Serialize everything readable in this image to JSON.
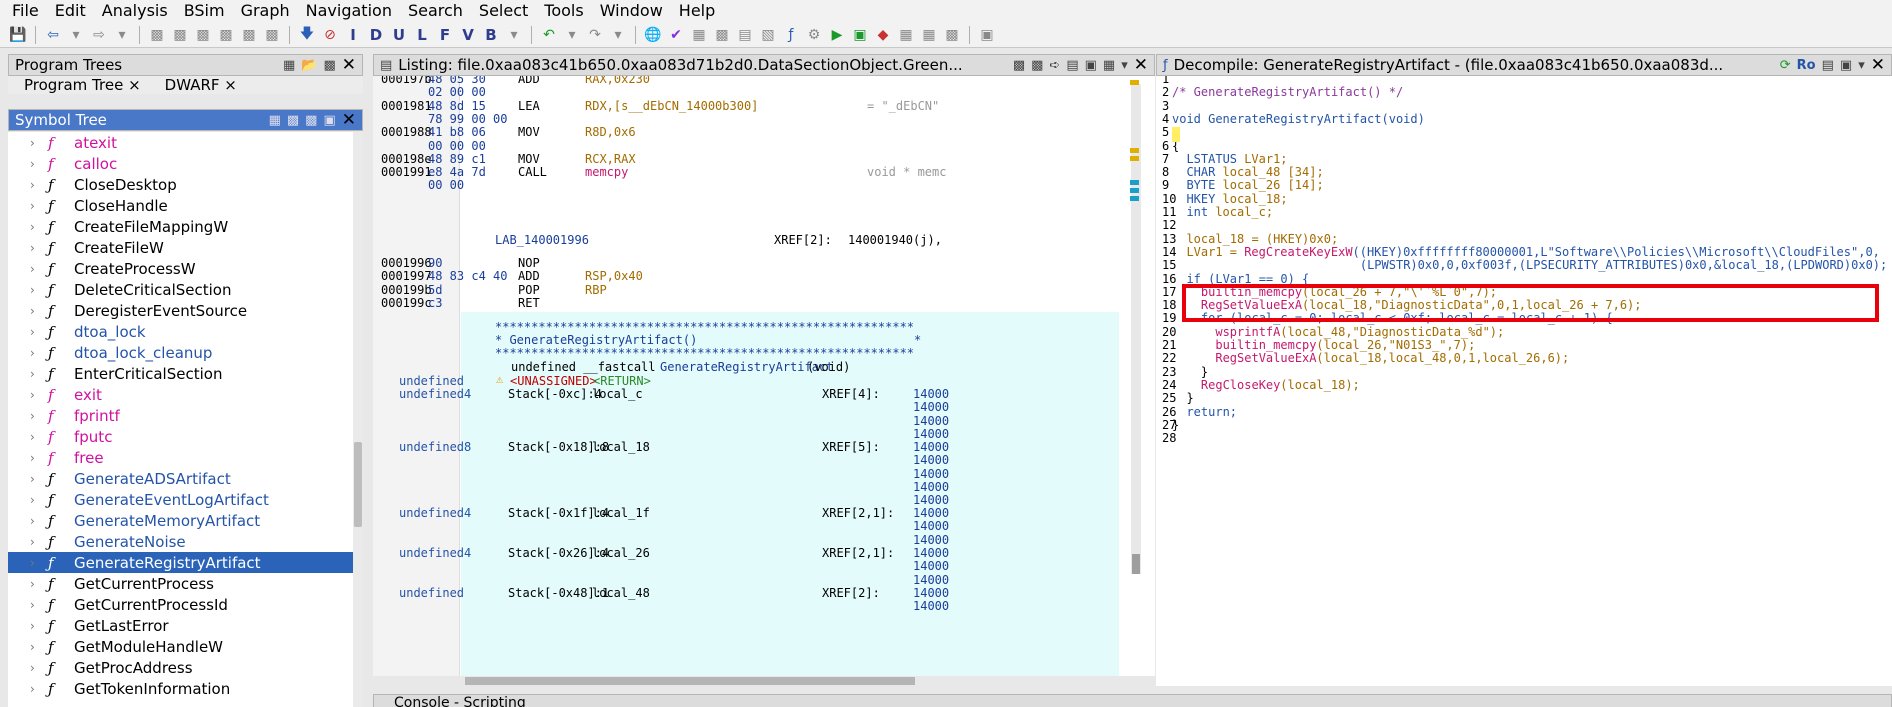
{
  "menu": [
    "File",
    "Edit",
    "Analysis",
    "BSim",
    "Graph",
    "Navigation",
    "Search",
    "Select",
    "Tools",
    "Window",
    "Help"
  ],
  "toolbar": {
    "letter_buttons": [
      "I",
      "D",
      "U",
      "L",
      "F",
      "V",
      "B"
    ]
  },
  "program_trees": {
    "title": "Program Trees",
    "tabs": [
      "Program Tree ×",
      "DWARF ×"
    ]
  },
  "symbol_tree": {
    "title": "Symbol Tree",
    "items": [
      {
        "name": "atexit",
        "color": "magenta"
      },
      {
        "name": "calloc",
        "color": "magenta"
      },
      {
        "name": "CloseDesktop",
        "color": "black"
      },
      {
        "name": "CloseHandle",
        "color": "black"
      },
      {
        "name": "CreateFileMappingW",
        "color": "black"
      },
      {
        "name": "CreateFileW",
        "color": "black"
      },
      {
        "name": "CreateProcessW",
        "color": "black"
      },
      {
        "name": "DeleteCriticalSection",
        "color": "black"
      },
      {
        "name": "DeregisterEventSource",
        "color": "black"
      },
      {
        "name": "dtoa_lock",
        "color": "blue"
      },
      {
        "name": "dtoa_lock_cleanup",
        "color": "blue"
      },
      {
        "name": "EnterCriticalSection",
        "color": "black"
      },
      {
        "name": "exit",
        "color": "magenta"
      },
      {
        "name": "fprintf",
        "color": "magenta"
      },
      {
        "name": "fputc",
        "color": "magenta"
      },
      {
        "name": "free",
        "color": "magenta"
      },
      {
        "name": "GenerateADSArtifact",
        "color": "blue"
      },
      {
        "name": "GenerateEventLogArtifact",
        "color": "blue"
      },
      {
        "name": "GenerateMemoryArtifact",
        "color": "blue"
      },
      {
        "name": "GenerateNoise",
        "color": "blue"
      },
      {
        "name": "GenerateRegistryArtifact",
        "color": "selected"
      },
      {
        "name": "GetCurrentProcess",
        "color": "black"
      },
      {
        "name": "GetCurrentProcessId",
        "color": "black"
      },
      {
        "name": "GetLastError",
        "color": "black"
      },
      {
        "name": "GetModuleHandleW",
        "color": "black"
      },
      {
        "name": "GetProcAddress",
        "color": "black"
      },
      {
        "name": "GetTokenInformation",
        "color": "black"
      }
    ]
  },
  "listing": {
    "title": "Listing:  file.0xaa083c41b650.0xaa083d71b2d0.DataSectionObject.Green...",
    "rows": [
      {
        "addr": "000197b",
        "bytes": "48 05 30",
        "mn": "ADD",
        "op": "RAX,0x230",
        "extra": ""
      },
      {
        "addr": "",
        "bytes": "02 00 00",
        "mn": "",
        "op": "",
        "extra": ""
      },
      {
        "addr": "0001981",
        "bytes": "48 8d 15",
        "mn": "LEA",
        "op": "RDX,[s__dEbCN_14000b300]",
        "extra": "= \"_dEbCN\""
      },
      {
        "addr": "",
        "bytes": "78 99 00 00",
        "mn": "",
        "op": "",
        "extra": ""
      },
      {
        "addr": "0001988",
        "bytes": "41 b8 06",
        "mn": "MOV",
        "op": "R8D,0x6",
        "extra": ""
      },
      {
        "addr": "",
        "bytes": "00 00 00",
        "mn": "",
        "op": "",
        "extra": ""
      },
      {
        "addr": "000198e",
        "bytes": "48 89 c1",
        "mn": "MOV",
        "op": "RCX,RAX",
        "extra": ""
      },
      {
        "addr": "0001991",
        "bytes": "e8 4a 7d",
        "mn": "CALL",
        "op": "memcpy",
        "extra": "void * memc"
      },
      {
        "addr": "",
        "bytes": "00 00",
        "mn": "",
        "op": "",
        "extra": ""
      }
    ],
    "label": "LAB_140001996",
    "label_xref": "XREF[2]:",
    "label_xref_val": "140001940(j),",
    "rows2": [
      {
        "addr": "0001996",
        "bytes": "90",
        "mn": "NOP",
        "op": ""
      },
      {
        "addr": "0001997",
        "bytes": "48 83 c4 40",
        "mn": "ADD",
        "op": "RSP,0x40"
      },
      {
        "addr": "000199b",
        "bytes": "5d",
        "mn": "POP",
        "op": "RBP"
      },
      {
        "addr": "000199c",
        "bytes": "c3",
        "mn": "RET",
        "op": ""
      }
    ],
    "stars": "**********************************************************",
    "fn_comment": "* GenerateRegistryArtifact()                              *",
    "signature_prefix": "undefined __fastcall ",
    "signature_name": "GenerateRegistryArtifact",
    "signature_suffix": "(void)",
    "ret_type": "undefined",
    "unassigned": "<UNASSIGNED>",
    "return_tag": "<RETURN>",
    "vars": [
      {
        "type": "undefined4",
        "stack": "Stack[-0xc]:4",
        "name": "local_c",
        "xref": "XREF[4]:",
        "refs": [
          "14000",
          "14000",
          "14000",
          "14000"
        ]
      },
      {
        "type": "undefined8",
        "stack": "Stack[-0x18]:8",
        "name": "local_18",
        "xref": "XREF[5]:",
        "refs": [
          "14000",
          "14000",
          "14000",
          "14000",
          "14000"
        ]
      },
      {
        "type": "undefined4",
        "stack": "Stack[-0x1f]:4",
        "name": "local_1f",
        "xref": "XREF[2,1]:",
        "refs": [
          "14000",
          "14000",
          "14000"
        ]
      },
      {
        "type": "undefined4",
        "stack": "Stack[-0x26]:4",
        "name": "local_26",
        "xref": "XREF[2,1]:",
        "refs": [
          "14000",
          "14000",
          "14000"
        ]
      },
      {
        "type": "undefined",
        "stack": "Stack[-0x48]:1",
        "name": "local_48",
        "xref": "XREF[2]:",
        "refs": [
          "14000",
          "14000"
        ]
      }
    ]
  },
  "decompile": {
    "title": "Decompile: GenerateRegistryArtifact -  (file.0xaa083c41b650.0xaa083d...",
    "ro": "Ro",
    "lines": [
      "1",
      "2",
      "3",
      "4",
      "5",
      "6",
      "7",
      "8",
      "9",
      "10",
      "11",
      "12",
      "13",
      "14",
      "15",
      "16",
      "17",
      "18",
      "19",
      "20",
      "21",
      "22",
      "23",
      "24",
      "25",
      "26",
      "27",
      "28"
    ],
    "code": {
      "l2": "/* GenerateRegistryArtifact() */",
      "l4a": "void",
      "l4b": " GenerateRegistryArtifact(void)",
      "l6": "{",
      "l7a": "  LSTATUS ",
      "l7b": "LVar1;",
      "l8a": "  CHAR ",
      "l8b": "local_48 [34];",
      "l9a": "  BYTE ",
      "l9b": "local_26 [14];",
      "l10a": "  HKEY ",
      "l10b": "local_18;",
      "l11a": "  int ",
      "l11b": "local_c;",
      "l13": "  local_18 = (HKEY)0x0;",
      "l14a": "  LVar1 = ",
      "l14b": "RegCreateKeyExW",
      "l14c": "((HKEY)0xffffffff80000001,L\"Software\\\\Policies\\\\Microsoft\\\\CloudFiles\",0,",
      "l15": "                          (LPWSTR)0x0,0,0xf003f,(LPSECURITY_ATTRIBUTES)0x0,&local_18,(LPDWORD)0x0);",
      "l16": "  if (LVar1 == 0) {",
      "l17a": "    builtin_memcpy",
      "l17b": "(local_26 + 7,\"\\'`%L`0\",7);",
      "l18a": "    RegSetValueExA",
      "l18b": "(local_18,\"DiagnosticData\",0,1,local_26 + 7,6);",
      "l19": "    for (local_c = 0; local_c < 0xf; local_c = local_c + 1) {",
      "l20a": "      wsprintfA",
      "l20b": "(local_48,\"DiagnosticData_%d\");",
      "l21a": "      builtin_memcpy",
      "l21b": "(local_26,\"N01S3_\",7);",
      "l22a": "      RegSetValueExA",
      "l22b": "(local_18,local_48,0,1,local_26,6);",
      "l23": "    }",
      "l24a": "    RegCloseKey",
      "l24b": "(local_18);",
      "l25": "  }",
      "l26": "  return;",
      "l27": "}"
    }
  },
  "console": {
    "title": "Console - Scripting"
  }
}
